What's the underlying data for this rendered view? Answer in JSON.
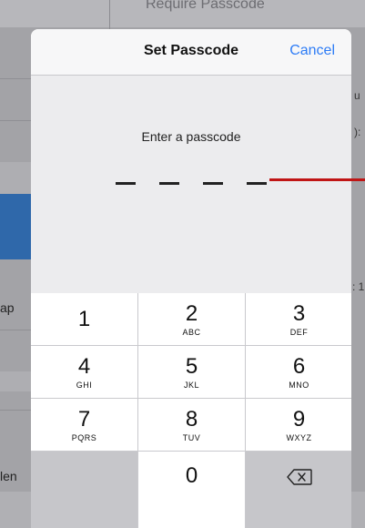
{
  "background": {
    "top_text": "Require Passcode",
    "left_labels": [
      "ap",
      "len"
    ],
    "right_labels": [
      "u",
      "):",
      ": 1"
    ]
  },
  "dialog": {
    "title": "Set Passcode",
    "cancel_label": "Cancel",
    "prompt": "Enter a passcode",
    "passcode_slots": 4
  },
  "keypad": {
    "keys": [
      {
        "digit": "1",
        "letters": ""
      },
      {
        "digit": "2",
        "letters": "ABC"
      },
      {
        "digit": "3",
        "letters": "DEF"
      },
      {
        "digit": "4",
        "letters": "GHI"
      },
      {
        "digit": "5",
        "letters": "JKL"
      },
      {
        "digit": "6",
        "letters": "MNO"
      },
      {
        "digit": "7",
        "letters": "PQRS"
      },
      {
        "digit": "8",
        "letters": "TUV"
      },
      {
        "digit": "9",
        "letters": "WXYZ"
      },
      {
        "digit": "0",
        "letters": ""
      }
    ],
    "backspace_icon": "backspace-icon"
  },
  "colors": {
    "accent": "#2d7cf6",
    "annotation": "#c01515",
    "selected_row": "#2f68aa"
  }
}
